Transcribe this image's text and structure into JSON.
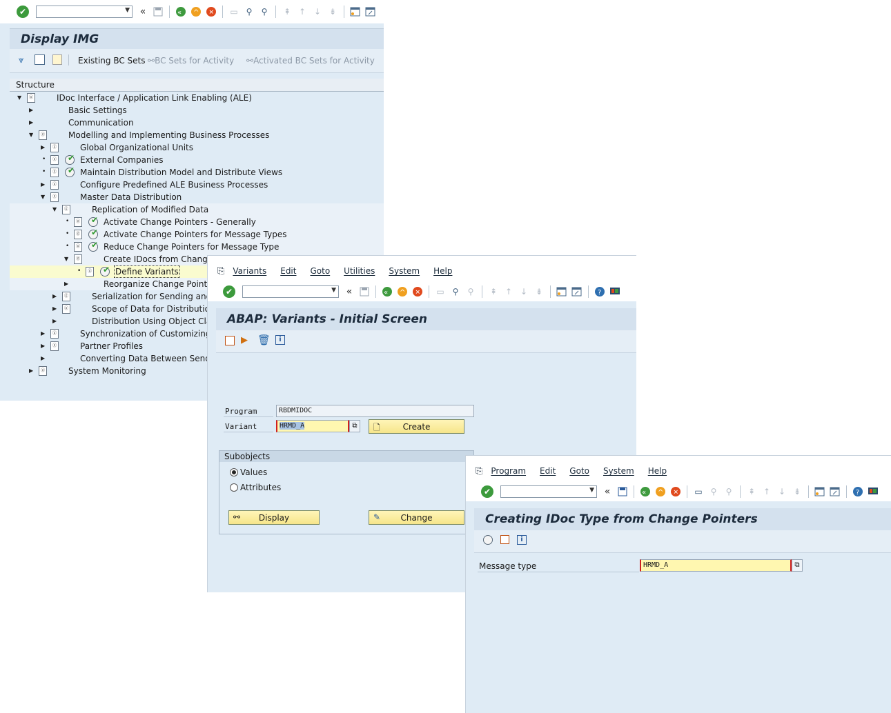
{
  "win1": {
    "title": "Display IMG",
    "bc_buttons": [
      "Existing BC Sets",
      "BC Sets for Activity",
      "Activated BC Sets for Activity"
    ],
    "structure_label": "Structure",
    "tree": [
      {
        "label": "IDoc Interface / Application Link Enabling (ALE)"
      },
      {
        "label": "Basic Settings"
      },
      {
        "label": "Communication"
      },
      {
        "label": "Modelling and Implementing Business Processes"
      },
      {
        "label": "Global Organizational Units"
      },
      {
        "label": "External Companies"
      },
      {
        "label": "Maintain Distribution Model and Distribute Views"
      },
      {
        "label": "Configure Predefined ALE Business Processes"
      },
      {
        "label": "Master Data Distribution"
      },
      {
        "label": "Replication of Modified Data"
      },
      {
        "label": "Activate Change Pointers - Generally"
      },
      {
        "label": "Activate Change Pointers for Message Types"
      },
      {
        "label": "Reduce Change Pointers for Message Type"
      },
      {
        "label": "Create IDocs from Change"
      },
      {
        "label": "Define Variants"
      },
      {
        "label": "Reorganize Change Pointers"
      },
      {
        "label": "Serialization for Sending and Re"
      },
      {
        "label": "Scope of Data for Distribution"
      },
      {
        "label": "Distribution Using Object Classe"
      },
      {
        "label": "Synchronization of Customizing Da"
      },
      {
        "label": "Partner Profiles"
      },
      {
        "label": "Converting Data Between Sender"
      },
      {
        "label": "System Monitoring"
      }
    ]
  },
  "win2": {
    "menu": [
      "Variants",
      "Edit",
      "Goto",
      "Utilities",
      "System",
      "Help"
    ],
    "title": "ABAP: Variants - Initial Screen",
    "program_label": "Program",
    "program_value": "RBDMIDOC",
    "variant_label": "Variant",
    "variant_value": "HRMD_A",
    "create_label": "Create",
    "subobjects_label": "Subobjects",
    "radio_values": "Values",
    "radio_attributes": "Attributes",
    "selected_radio": "Values",
    "display_label": "Display",
    "change_label": "Change"
  },
  "win3": {
    "menu": [
      "Program",
      "Edit",
      "Goto",
      "System",
      "Help"
    ],
    "title": "Creating IDoc Type from Change Pointers",
    "message_type_label": "Message type",
    "message_type_value": "HRMD_A"
  },
  "colors": {
    "sap_bg": "#dfebf5",
    "title_bg": "#d4e1ee",
    "highlight": "#fff7b0",
    "field_border": "#9aa8b8"
  }
}
